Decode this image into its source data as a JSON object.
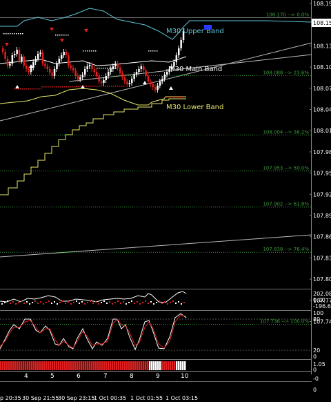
{
  "price_axis": {
    "labels": [
      "108.190",
      "108.158",
      "108.130",
      "108.100",
      "108.070",
      "108.040",
      "108.010",
      "107.980",
      "107.950",
      "107.920",
      "107.890",
      "107.860",
      "107.830",
      "107.800",
      "107.770",
      "107.740"
    ],
    "current_price": "108.158",
    "current_price_color": "#ffffff"
  },
  "fib_levels": [
    {
      "label": "108.170 --> 0.0%",
      "price": 108.17
    },
    {
      "label": "108.088 --> 23.6%",
      "price": 108.088
    },
    {
      "label": "108.004 --> 38.2%",
      "price": 108.004
    },
    {
      "label": "107.953 --> 50.0%",
      "price": 107.953
    },
    {
      "label": "107.902 --> 61.8%",
      "price": 107.902
    },
    {
      "label": "107.838 --> 76.4%",
      "price": 107.838
    },
    {
      "label": "107.736 --> 100.0%",
      "price": 107.736
    }
  ],
  "bands": {
    "upper_label": "M30 Upper Band",
    "upper_color": "#5fc6d6",
    "main_label": "M30 Main Band",
    "main_color": "#ffffff",
    "lower_label": "M30 Lower Band",
    "lower_color": "#e8e86a"
  },
  "indicator1": {
    "labels": [
      "202.088",
      "0.00",
      "-196.667"
    ]
  },
  "indicator2": {
    "labels": [
      "100",
      "80",
      "20",
      "0"
    ]
  },
  "indicator3": {
    "labels": [
      "1.05",
      "0",
      "-0",
      "0"
    ]
  },
  "day_labels": [
    "4",
    "5",
    "6",
    "7",
    "8",
    "9",
    "10"
  ],
  "time_labels": [
    "p 20:35",
    "30 Sep 21:55",
    "30 Sep 23:15",
    "1 Oct 00:35",
    "1 Oct 01:55",
    "1 Oct 03:15"
  ],
  "colors": {
    "fib": "#3c9c3c",
    "bull": "#ffffff",
    "bear": "#e02020",
    "grid": "#3a3a3a"
  }
}
